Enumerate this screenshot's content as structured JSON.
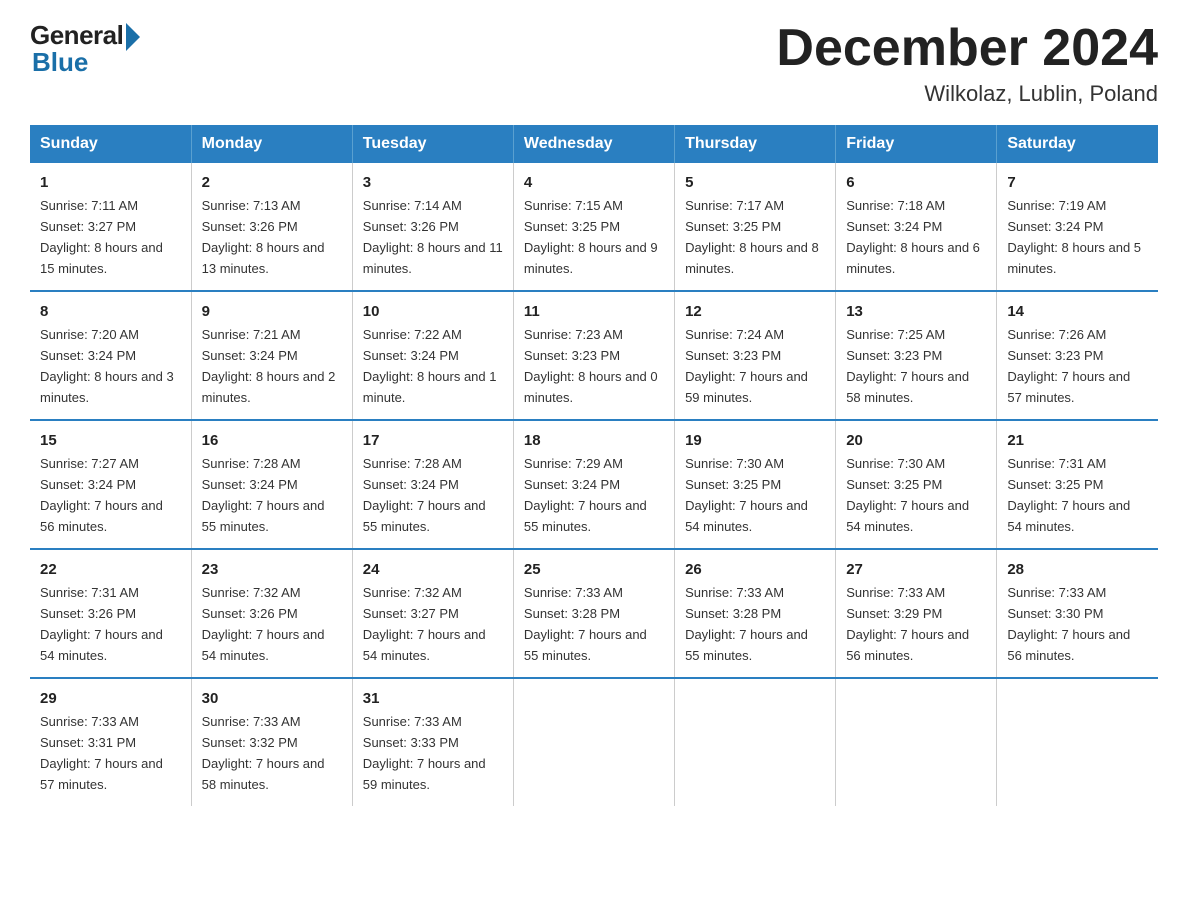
{
  "header": {
    "logo_general": "General",
    "logo_blue": "Blue",
    "month_title": "December 2024",
    "location": "Wilkolaz, Lublin, Poland"
  },
  "weekdays": [
    "Sunday",
    "Monday",
    "Tuesday",
    "Wednesday",
    "Thursday",
    "Friday",
    "Saturday"
  ],
  "weeks": [
    [
      {
        "day": "1",
        "sunrise": "7:11 AM",
        "sunset": "3:27 PM",
        "daylight": "8 hours and 15 minutes."
      },
      {
        "day": "2",
        "sunrise": "7:13 AM",
        "sunset": "3:26 PM",
        "daylight": "8 hours and 13 minutes."
      },
      {
        "day": "3",
        "sunrise": "7:14 AM",
        "sunset": "3:26 PM",
        "daylight": "8 hours and 11 minutes."
      },
      {
        "day": "4",
        "sunrise": "7:15 AM",
        "sunset": "3:25 PM",
        "daylight": "8 hours and 9 minutes."
      },
      {
        "day": "5",
        "sunrise": "7:17 AM",
        "sunset": "3:25 PM",
        "daylight": "8 hours and 8 minutes."
      },
      {
        "day": "6",
        "sunrise": "7:18 AM",
        "sunset": "3:24 PM",
        "daylight": "8 hours and 6 minutes."
      },
      {
        "day": "7",
        "sunrise": "7:19 AM",
        "sunset": "3:24 PM",
        "daylight": "8 hours and 5 minutes."
      }
    ],
    [
      {
        "day": "8",
        "sunrise": "7:20 AM",
        "sunset": "3:24 PM",
        "daylight": "8 hours and 3 minutes."
      },
      {
        "day": "9",
        "sunrise": "7:21 AM",
        "sunset": "3:24 PM",
        "daylight": "8 hours and 2 minutes."
      },
      {
        "day": "10",
        "sunrise": "7:22 AM",
        "sunset": "3:24 PM",
        "daylight": "8 hours and 1 minute."
      },
      {
        "day": "11",
        "sunrise": "7:23 AM",
        "sunset": "3:23 PM",
        "daylight": "8 hours and 0 minutes."
      },
      {
        "day": "12",
        "sunrise": "7:24 AM",
        "sunset": "3:23 PM",
        "daylight": "7 hours and 59 minutes."
      },
      {
        "day": "13",
        "sunrise": "7:25 AM",
        "sunset": "3:23 PM",
        "daylight": "7 hours and 58 minutes."
      },
      {
        "day": "14",
        "sunrise": "7:26 AM",
        "sunset": "3:23 PM",
        "daylight": "7 hours and 57 minutes."
      }
    ],
    [
      {
        "day": "15",
        "sunrise": "7:27 AM",
        "sunset": "3:24 PM",
        "daylight": "7 hours and 56 minutes."
      },
      {
        "day": "16",
        "sunrise": "7:28 AM",
        "sunset": "3:24 PM",
        "daylight": "7 hours and 55 minutes."
      },
      {
        "day": "17",
        "sunrise": "7:28 AM",
        "sunset": "3:24 PM",
        "daylight": "7 hours and 55 minutes."
      },
      {
        "day": "18",
        "sunrise": "7:29 AM",
        "sunset": "3:24 PM",
        "daylight": "7 hours and 55 minutes."
      },
      {
        "day": "19",
        "sunrise": "7:30 AM",
        "sunset": "3:25 PM",
        "daylight": "7 hours and 54 minutes."
      },
      {
        "day": "20",
        "sunrise": "7:30 AM",
        "sunset": "3:25 PM",
        "daylight": "7 hours and 54 minutes."
      },
      {
        "day": "21",
        "sunrise": "7:31 AM",
        "sunset": "3:25 PM",
        "daylight": "7 hours and 54 minutes."
      }
    ],
    [
      {
        "day": "22",
        "sunrise": "7:31 AM",
        "sunset": "3:26 PM",
        "daylight": "7 hours and 54 minutes."
      },
      {
        "day": "23",
        "sunrise": "7:32 AM",
        "sunset": "3:26 PM",
        "daylight": "7 hours and 54 minutes."
      },
      {
        "day": "24",
        "sunrise": "7:32 AM",
        "sunset": "3:27 PM",
        "daylight": "7 hours and 54 minutes."
      },
      {
        "day": "25",
        "sunrise": "7:33 AM",
        "sunset": "3:28 PM",
        "daylight": "7 hours and 55 minutes."
      },
      {
        "day": "26",
        "sunrise": "7:33 AM",
        "sunset": "3:28 PM",
        "daylight": "7 hours and 55 minutes."
      },
      {
        "day": "27",
        "sunrise": "7:33 AM",
        "sunset": "3:29 PM",
        "daylight": "7 hours and 56 minutes."
      },
      {
        "day": "28",
        "sunrise": "7:33 AM",
        "sunset": "3:30 PM",
        "daylight": "7 hours and 56 minutes."
      }
    ],
    [
      {
        "day": "29",
        "sunrise": "7:33 AM",
        "sunset": "3:31 PM",
        "daylight": "7 hours and 57 minutes."
      },
      {
        "day": "30",
        "sunrise": "7:33 AM",
        "sunset": "3:32 PM",
        "daylight": "7 hours and 58 minutes."
      },
      {
        "day": "31",
        "sunrise": "7:33 AM",
        "sunset": "3:33 PM",
        "daylight": "7 hours and 59 minutes."
      },
      null,
      null,
      null,
      null
    ]
  ]
}
